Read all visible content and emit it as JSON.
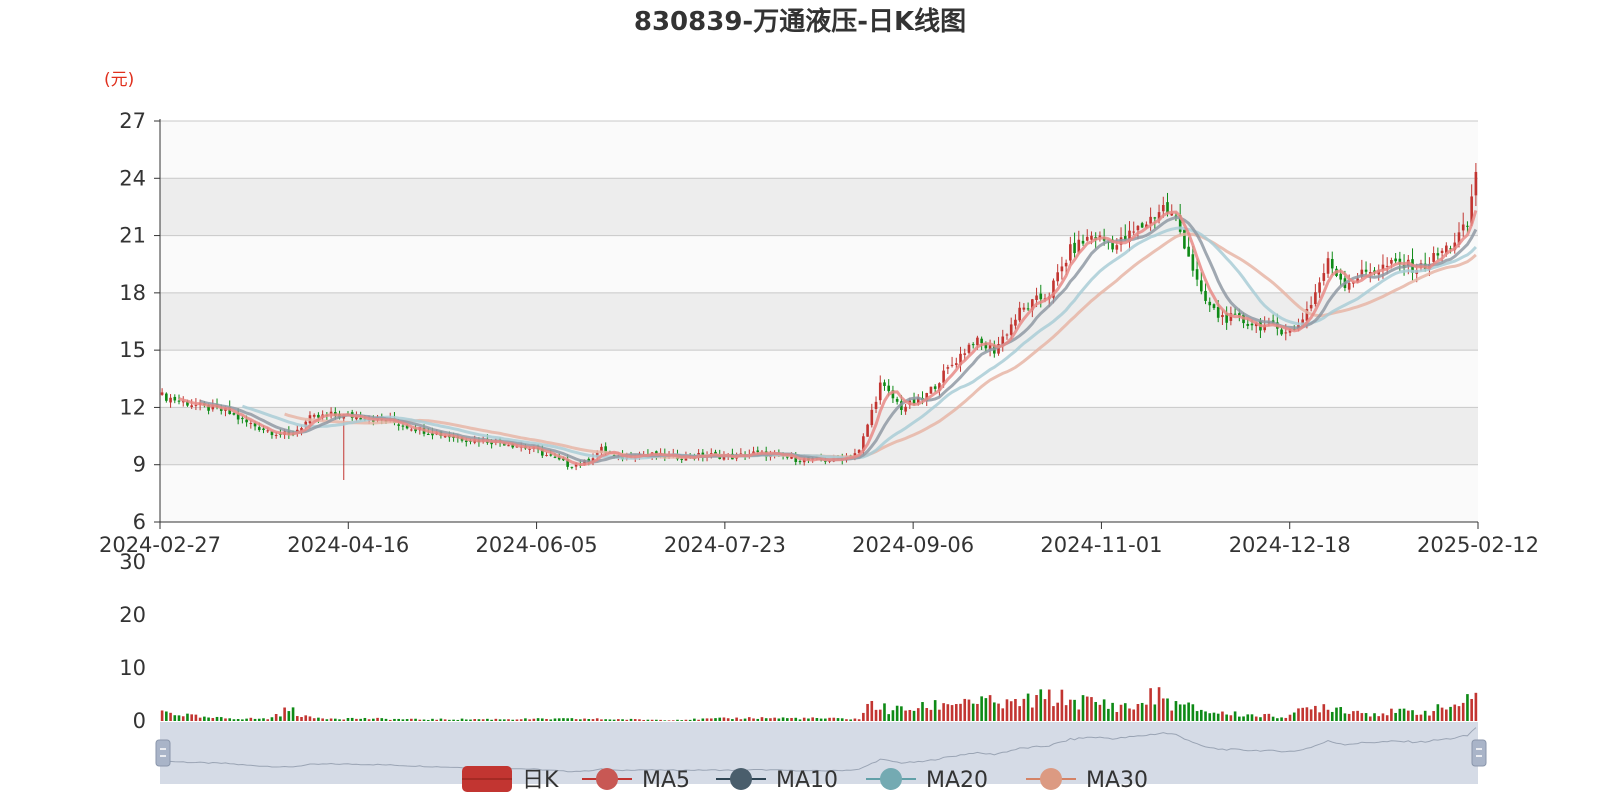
{
  "title": "830839-万通液压-日K线图",
  "unit_label": "(元)",
  "colors": {
    "up": "#c23531",
    "down": "#0e8a16",
    "ma5": "#e88a86",
    "ma10": "#8f99a3",
    "ma20": "#a9cdd6",
    "ma30": "#e6b5a6",
    "band": "#ededed",
    "band_light": "#fafafa",
    "grid": "#c8c8c8",
    "slider_bg": "#d5dbe6"
  },
  "legend": [
    {
      "label": "日K",
      "icon": "candle-swatch",
      "color": "#c23531"
    },
    {
      "label": "MA5",
      "icon": "line-dot",
      "color": "#c23531"
    },
    {
      "label": "MA10",
      "icon": "line-dot",
      "color": "#2f4554"
    },
    {
      "label": "MA20",
      "icon": "line-dot",
      "color": "#61a0a8"
    },
    {
      "label": "MA30",
      "icon": "line-dot",
      "color": "#d48265"
    }
  ],
  "chart_data": {
    "type": "candlestick",
    "title": "830839-万通液压-日K线图",
    "ylabel": "(元)",
    "ylim": [
      6,
      27
    ],
    "y_ticks": [
      6,
      9,
      12,
      15,
      18,
      21,
      24,
      27
    ],
    "x_tick_labels": [
      "2024-02-27",
      "2024-04-16",
      "2024-06-05",
      "2024-07-23",
      "2024-09-06",
      "2024-11-01",
      "2024-12-18",
      "2025-02-12"
    ],
    "volume_ylim": [
      0,
      30
    ],
    "volume_ticks": [
      0,
      10,
      20,
      30
    ],
    "close_anchors": [
      [
        0,
        12.6
      ],
      [
        5,
        12.3
      ],
      [
        10,
        12.0
      ],
      [
        15,
        11.8
      ],
      [
        20,
        11.2
      ],
      [
        25,
        10.8
      ],
      [
        30,
        10.5
      ],
      [
        35,
        11.4
      ],
      [
        40,
        11.6
      ],
      [
        48,
        11.5
      ],
      [
        55,
        11.2
      ],
      [
        62,
        10.8
      ],
      [
        70,
        10.4
      ],
      [
        80,
        10.2
      ],
      [
        88,
        9.8
      ],
      [
        96,
        9.0
      ],
      [
        100,
        9.1
      ],
      [
        104,
        9.8
      ],
      [
        108,
        9.3
      ],
      [
        112,
        9.6
      ],
      [
        120,
        9.4
      ],
      [
        130,
        9.5
      ],
      [
        135,
        9.4
      ],
      [
        140,
        9.6
      ],
      [
        145,
        9.5
      ],
      [
        150,
        9.3
      ],
      [
        155,
        9.2
      ],
      [
        160,
        9.3
      ],
      [
        165,
        9.7
      ],
      [
        170,
        13.2
      ],
      [
        175,
        12.0
      ],
      [
        180,
        12.4
      ],
      [
        186,
        14.0
      ],
      [
        192,
        15.5
      ],
      [
        197,
        15.0
      ],
      [
        203,
        17.0
      ],
      [
        210,
        18.0
      ],
      [
        215,
        20.2
      ],
      [
        220,
        21.0
      ],
      [
        226,
        20.5
      ],
      [
        232,
        21.5
      ],
      [
        237,
        22.5
      ],
      [
        240,
        21.8
      ],
      [
        243,
        20.0
      ],
      [
        246,
        17.8
      ],
      [
        250,
        16.8
      ],
      [
        256,
        16.5
      ],
      [
        262,
        16.2
      ],
      [
        268,
        16.0
      ],
      [
        272,
        17.5
      ],
      [
        276,
        19.6
      ],
      [
        280,
        18.5
      ],
      [
        286,
        19.2
      ],
      [
        292,
        19.5
      ],
      [
        298,
        19.3
      ],
      [
        305,
        20.5
      ],
      [
        309,
        21.5
      ],
      [
        311,
        24.4
      ]
    ],
    "volume_anchors": [
      [
        0,
        1.8
      ],
      [
        10,
        0.6
      ],
      [
        25,
        0.4
      ],
      [
        30,
        2.2
      ],
      [
        35,
        0.6
      ],
      [
        60,
        0.3
      ],
      [
        100,
        0.4
      ],
      [
        120,
        0.2
      ],
      [
        140,
        0.6
      ],
      [
        165,
        0.4
      ],
      [
        168,
        3.5
      ],
      [
        172,
        2.0
      ],
      [
        180,
        2.5
      ],
      [
        190,
        4.0
      ],
      [
        200,
        3.0
      ],
      [
        210,
        4.5
      ],
      [
        220,
        3.5
      ],
      [
        230,
        2.5
      ],
      [
        235,
        5.0
      ],
      [
        240,
        3.0
      ],
      [
        250,
        1.5
      ],
      [
        265,
        0.8
      ],
      [
        275,
        3.0
      ],
      [
        285,
        1.5
      ],
      [
        300,
        1.8
      ],
      [
        311,
        4.0
      ]
    ],
    "bar_count": 312
  }
}
